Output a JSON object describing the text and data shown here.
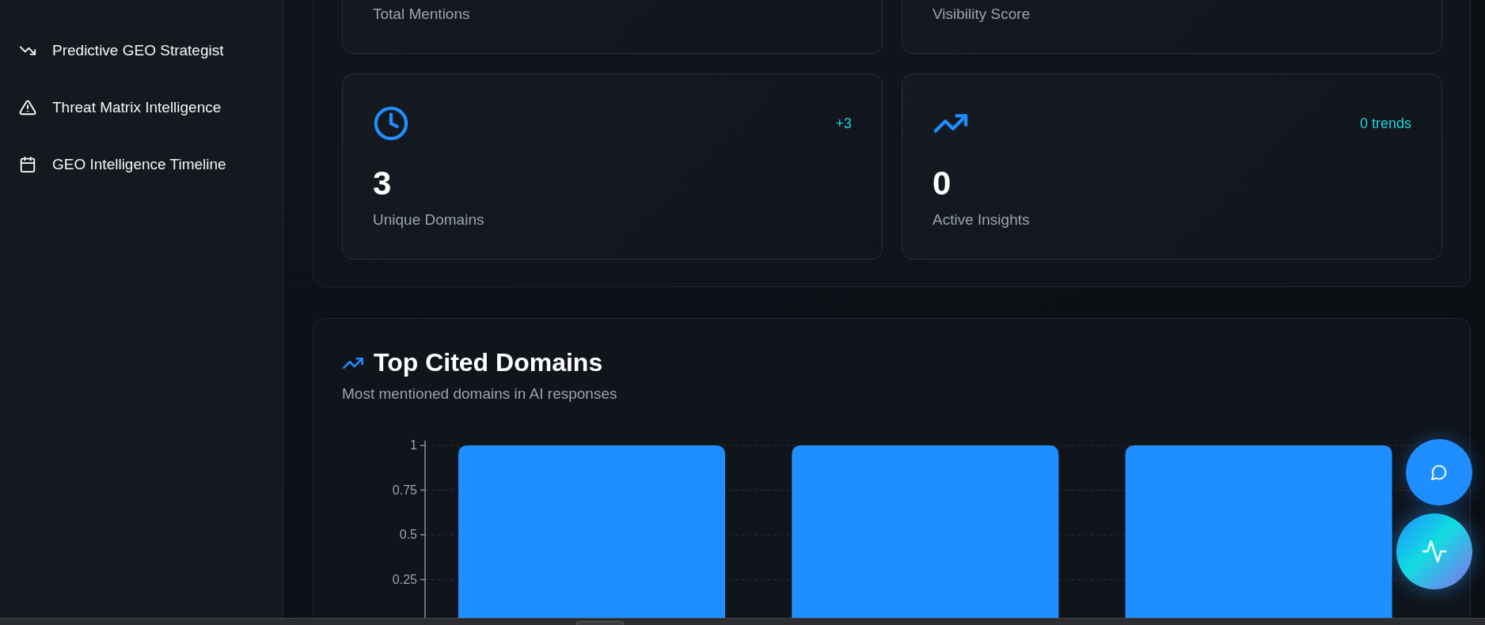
{
  "sidebar": {
    "items": [
      {
        "label": "Predictive GEO Strategist"
      },
      {
        "label": "Threat Matrix Intelligence"
      },
      {
        "label": "GEO Intelligence Timeline"
      }
    ]
  },
  "stat_cards": [
    {
      "label": "Total Mentions"
    },
    {
      "label": "Visibility Score"
    },
    {
      "value": "3",
      "label": "Unique Domains",
      "change": "+3"
    },
    {
      "value": "0",
      "label": "Active Insights",
      "change": "0 trends"
    }
  ],
  "domains_panel": {
    "title": "Top Cited Domains",
    "subtitle": "Most mentioned domains in AI responses",
    "chart_data": {
      "type": "bar",
      "grid": true,
      "ylim": [
        0,
        1
      ],
      "yticks": [
        0.25,
        0.5,
        0.75,
        1
      ],
      "series": [
        {
          "color": "#1f8fff",
          "values": [
            1,
            1,
            1
          ]
        }
      ]
    }
  }
}
